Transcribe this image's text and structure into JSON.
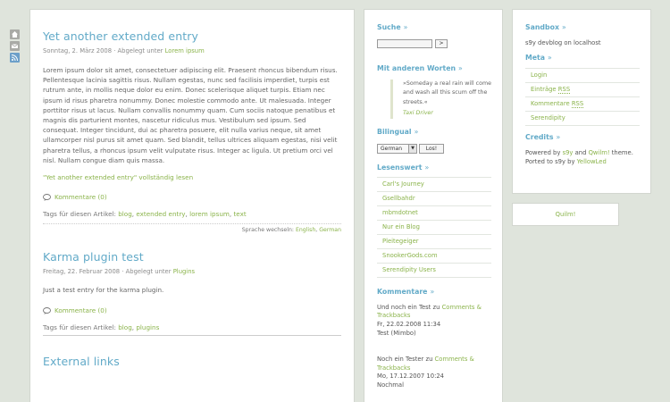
{
  "main": {
    "entries": [
      {
        "title": "Yet another extended entry",
        "meta_prefix": "Sonntag, 2. März 2008 · Abgelegt unter ",
        "category": "Lorem ipsum",
        "body": "Lorem ipsum dolor sit amet, consectetuer adipiscing elit. Praesent rhoncus bibendum risus. Pellentesque lacinia sagittis risus. Nullam egestas, nunc sed facilisis imperdiet, turpis est rutrum ante, in mollis neque dolor eu enim. Donec scelerisque aliquet turpis. Etiam nec ipsum id risus pharetra nonummy. Donec molestie commodo ante. Ut malesuada. Integer porttitor risus ut lacus. Nullam convallis nonummy quam. Cum sociis natoque penatibus et magnis dis parturient montes, nascetur ridiculus mus. Vestibulum sed ipsum. Sed consequat. Integer tincidunt, dui ac pharetra posuere, elit nulla varius neque, sit amet ullamcorper nisl purus sit amet quam. Sed blandit, tellus ultrices aliquam egestas, nisi velit pharetra tellus, a rhoncus ipsum velit vulputate risus. Integer ac ligula. Ut pretium orci vel nisl. Nullam congue diam quis massa.",
        "extended_link": "\"Yet another extended entry\" vollständig lesen",
        "comments": "Kommentare (0)",
        "tags_label": "Tags für diesen Artikel: ",
        "tags": [
          "blog",
          "extended entry",
          "lorem ipsum",
          "text"
        ],
        "lang_label": "Sprache wechseln: ",
        "lang_options": [
          "English",
          "German"
        ]
      },
      {
        "title": "Karma plugin test",
        "meta_prefix": "Freitag, 22. Februar 2008 · Abgelegt unter ",
        "category": "Plugins",
        "body": "Just a test entry for the karma plugin.",
        "comments": "Kommentare (0)",
        "tags_label": "Tags für diesen Artikel: ",
        "tags": [
          "blog",
          "plugins"
        ]
      },
      {
        "title": "External links"
      }
    ]
  },
  "sidebar_mid": {
    "search_title": "Suche",
    "search_button": ">",
    "quote_title": "Mit anderen Worten",
    "quote_text": "»Someday a real rain will come and wash all this scum off the streets.«",
    "quote_source": "Taxi Driver",
    "bilingual_title": "Bilingual",
    "lang_selected": "German",
    "lang_go": "Los!",
    "blogroll_title": "Lesenswert",
    "blogroll": [
      "Carl's Journey",
      "Gsellbahdr",
      "mbmdotnet",
      "Nur ein Blog",
      "Pleitegeiger",
      "SnookerGods.com",
      "Serendipity Users"
    ],
    "comments_title": "Kommentare",
    "comments": [
      {
        "prefix": "Und noch ein Test zu ",
        "link": "Comments & Trackbacks",
        "date": "Fr, 22.02.2008 11:34",
        "author": "Test (Mimbo)"
      },
      {
        "prefix": "Noch ein Tester zu ",
        "link": "Comments & Trackbacks",
        "date": "Mo, 17.12.2007 10:24",
        "author": "Nochmal"
      }
    ]
  },
  "sidebar_right": {
    "sandbox_title": "Sandbox",
    "sandbox_text": "s9y devblog on localhost",
    "meta_title": "Meta",
    "meta_items": {
      "login": "Login",
      "entries_prefix": "Einträge ",
      "comments_prefix": "Kommentare ",
      "rss": "RSS",
      "serendipity": "Serendipity"
    },
    "credits_title": "Credits",
    "credits": {
      "powered": "Powered by ",
      "s9y": "s9y",
      "and": " and ",
      "quilm": "Qwilm!",
      "theme": " theme.",
      "ported": "Ported to s9y by ",
      "yellowled": "YellowLed"
    },
    "quilm_box": "Quilm!"
  },
  "icons": [
    "home-icon",
    "mail-icon",
    "rss-icon"
  ]
}
